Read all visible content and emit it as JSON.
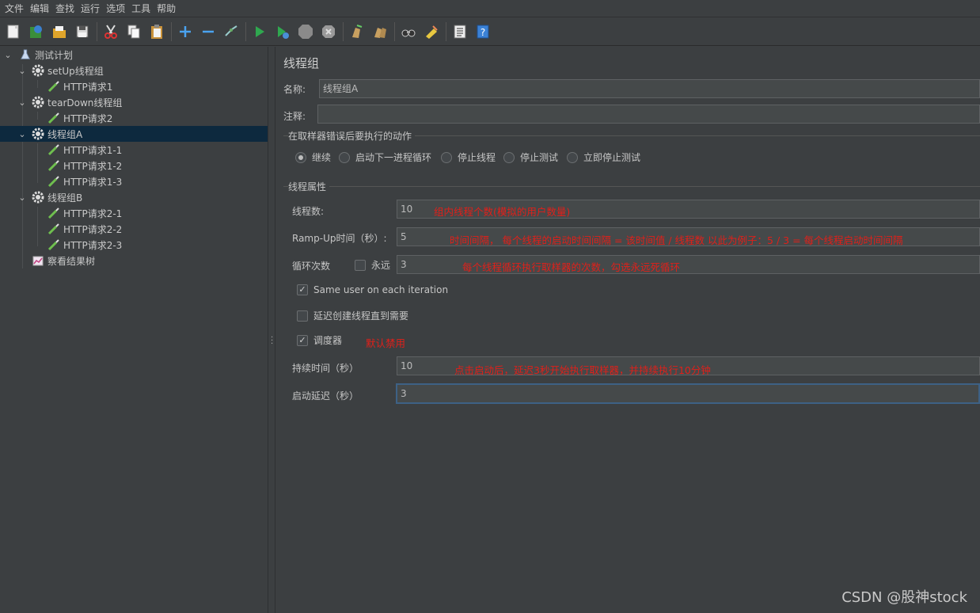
{
  "menu": [
    "文件",
    "编辑",
    "查找",
    "运行",
    "选项",
    "工具",
    "帮助"
  ],
  "toolbar": {
    "buttons": [
      "new-icon",
      "templates-icon",
      "open-icon",
      "save-icon",
      "cut-icon",
      "copy-icon",
      "paste-icon",
      "expand-icon",
      "collapse-icon",
      "toggle-icon",
      "start-icon",
      "start-no-pause-icon",
      "stop-icon",
      "shutdown-icon",
      "clear-icon",
      "clear-all-icon",
      "search-icon",
      "reset-search-icon",
      "function-helper-icon",
      "help-icon"
    ]
  },
  "tree": {
    "items": [
      {
        "label": "测试计划",
        "level": 0,
        "type": "plan",
        "expanded": true
      },
      {
        "label": "setUp线程组",
        "level": 1,
        "type": "group",
        "expanded": true
      },
      {
        "label": "HTTP请求1",
        "level": 2,
        "type": "sampler"
      },
      {
        "label": "tearDown线程组",
        "level": 1,
        "type": "group",
        "expanded": true
      },
      {
        "label": "HTTP请求2",
        "level": 2,
        "type": "sampler"
      },
      {
        "label": "线程组A",
        "level": 1,
        "type": "group",
        "expanded": true,
        "selected": true
      },
      {
        "label": "HTTP请求1-1",
        "level": 2,
        "type": "sampler"
      },
      {
        "label": "HTTP请求1-2",
        "level": 2,
        "type": "sampler"
      },
      {
        "label": "HTTP请求1-3",
        "level": 2,
        "type": "sampler"
      },
      {
        "label": "线程组B",
        "level": 1,
        "type": "group",
        "expanded": true
      },
      {
        "label": "HTTP请求2-1",
        "level": 2,
        "type": "sampler"
      },
      {
        "label": "HTTP请求2-2",
        "level": 2,
        "type": "sampler"
      },
      {
        "label": "HTTP请求2-3",
        "level": 2,
        "type": "sampler"
      },
      {
        "label": "察看结果树",
        "level": 1,
        "type": "listener"
      }
    ]
  },
  "panel": {
    "title": "线程组",
    "name_label": "名称:",
    "name_value": "线程组A",
    "comment_label": "注释:",
    "comment_value": "",
    "error_section": "在取样器错误后要执行的动作",
    "error_options": [
      "继续",
      "启动下一进程循环",
      "停止线程",
      "停止测试",
      "立即停止测试"
    ],
    "error_selected": "继续",
    "props_section": "线程属性",
    "threads_label": "线程数:",
    "threads_value": "10",
    "threads_note": "组内线程个数(模拟的用户数量)",
    "rampup_label": "Ramp-Up时间（秒）:",
    "rampup_value": "5",
    "rampup_note": "时间间隔， 每个线程的启动时间间隔 = 该时间值 / 线程数   以此为例子：5 / 3 = 每个线程启动时间间隔",
    "loop_label": "循环次数",
    "forever_label": "永远",
    "forever_checked": false,
    "loop_value": "3",
    "loop_note": "每个线程循环执行取样器的次数，勾选永远死循环",
    "same_user_label": "Same user on each iteration",
    "same_user_checked": true,
    "delay_create_label": "延迟创建线程直到需要",
    "delay_create_checked": false,
    "scheduler_label": "调度器",
    "scheduler_checked": true,
    "scheduler_note": "默认禁用",
    "duration_label": "持续时间（秒）",
    "duration_value": "10",
    "duration_note": "点击启动后，延迟3秒开始执行取样器，并持续执行10分钟",
    "startup_delay_label": "启动延迟（秒）",
    "startup_delay_value": "3"
  },
  "watermark": "CSDN @股神stock",
  "colors": {
    "background": "#3c3f41",
    "selected_row": "#0d293e",
    "annotation": "#e0201a",
    "field_bg": "#45494a",
    "focus_border": "#3d6185"
  }
}
